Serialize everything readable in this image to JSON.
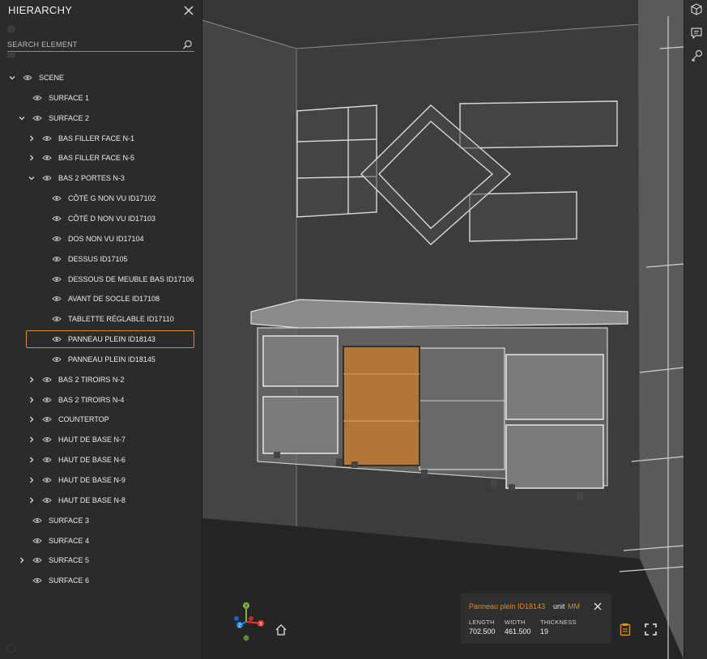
{
  "panel": {
    "title": "HIERARCHY",
    "search_placeholder": "SEARCH ELEMENT",
    "tree": [
      {
        "label": "SCENE",
        "level": 0,
        "chevron": "down",
        "selected": false
      },
      {
        "label": "SURFACE 1",
        "level": 1,
        "chevron": "none",
        "selected": false
      },
      {
        "label": "SURFACE 2",
        "level": 1,
        "chevron": "down",
        "selected": false
      },
      {
        "label": "BAS FILLER FACE N-1",
        "level": 2,
        "chevron": "right",
        "selected": false
      },
      {
        "label": "BAS FILLER FACE N-5",
        "level": 2,
        "chevron": "right",
        "selected": false
      },
      {
        "label": "BAS 2 PORTES N-3",
        "level": 2,
        "chevron": "down",
        "selected": false
      },
      {
        "label": "CÔTÉ G NON VU ID17102",
        "level": 3,
        "chevron": "none",
        "selected": false
      },
      {
        "label": "CÔTÉ D NON VU ID17103",
        "level": 3,
        "chevron": "none",
        "selected": false
      },
      {
        "label": "DOS NON VU ID17104",
        "level": 3,
        "chevron": "none",
        "selected": false
      },
      {
        "label": "DESSUS ID17105",
        "level": 3,
        "chevron": "none",
        "selected": false
      },
      {
        "label": "DESSOUS DE MEUBLE BAS ID17106",
        "level": 3,
        "chevron": "none",
        "selected": false
      },
      {
        "label": "AVANT DE SOCLE ID17108",
        "level": 3,
        "chevron": "none",
        "selected": false
      },
      {
        "label": "TABLETTE RÉGLABLE ID17110",
        "level": 3,
        "chevron": "none",
        "selected": false
      },
      {
        "label": "PANNEAU PLEIN ID18143",
        "level": 3,
        "chevron": "none",
        "selected": true
      },
      {
        "label": "PANNEAU PLEIN ID18145",
        "level": 3,
        "chevron": "none",
        "selected": false
      },
      {
        "label": "BAS 2 TIROIRS N-2",
        "level": 2,
        "chevron": "right",
        "selected": false
      },
      {
        "label": "BAS 2 TIROIRS N-4",
        "level": 2,
        "chevron": "right",
        "selected": false
      },
      {
        "label": "COUNTERTOP",
        "level": 2,
        "chevron": "right",
        "selected": false
      },
      {
        "label": "HAUT DE BASE N-7",
        "level": 2,
        "chevron": "right",
        "selected": false
      },
      {
        "label": "HAUT DE BASE N-6",
        "level": 2,
        "chevron": "right",
        "selected": false
      },
      {
        "label": "HAUT DE BASE N-9",
        "level": 2,
        "chevron": "right",
        "selected": false
      },
      {
        "label": "HAUT DE BASE N-8",
        "level": 2,
        "chevron": "right",
        "selected": false
      },
      {
        "label": "SURFACE 3",
        "level": 1,
        "chevron": "none",
        "selected": false
      },
      {
        "label": "SURFACE 4",
        "level": 1,
        "chevron": "none",
        "selected": false
      },
      {
        "label": "SURFACE 5",
        "level": 1,
        "chevron": "right",
        "selected": false
      },
      {
        "label": "SURFACE 6",
        "level": 1,
        "chevron": "none",
        "selected": false
      }
    ]
  },
  "info": {
    "name": "Panneau plein ID18143",
    "unit_label": "unit",
    "unit_value": "MM",
    "length_label": "LENGTH",
    "width_label": "WIDTH",
    "thickness_label": "THICKNESS",
    "length": "702.500",
    "width": "461.500",
    "thickness": "19"
  },
  "axis_gizmo": {
    "x": "X",
    "y": "Y",
    "z": "Z"
  },
  "toolbar_icons": [
    "cube-icon",
    "comment-icon",
    "key-icon"
  ],
  "colors": {
    "accent": "#e58a1f",
    "panel_bg": "#2b2b2b",
    "viewport_bg": "#3a3a3a",
    "axis_x": "#e53935",
    "axis_y": "#7cb342",
    "axis_z": "#1e88e5"
  }
}
